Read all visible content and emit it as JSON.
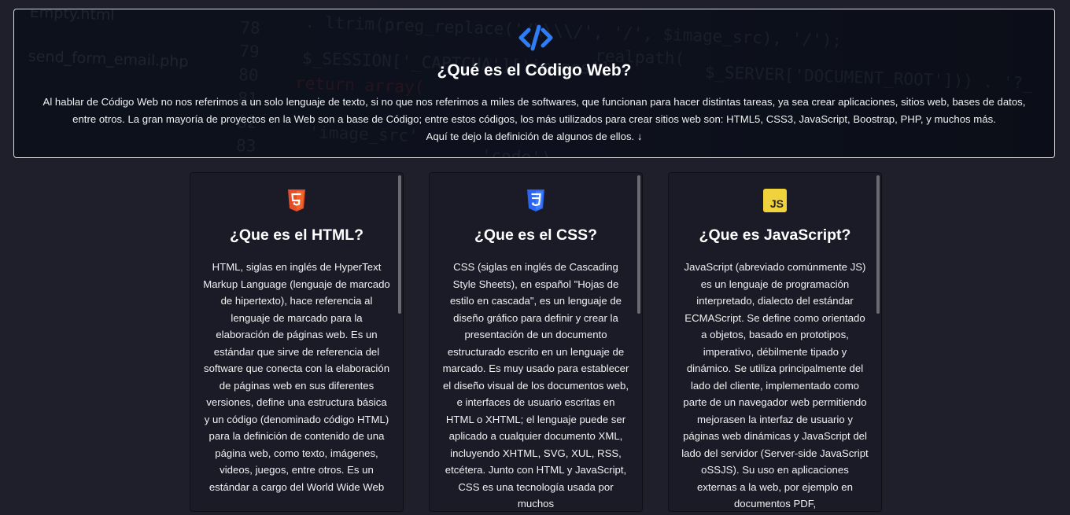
{
  "hero": {
    "title": "¿Qué es el Código Web?",
    "paragraph": "Al hablar de Código Web no nos referimos a un solo lenguaje de texto, si no que nos referimos a miles de softwares, que funcionan para hacer distintas tareas, ya sea crear aplicaciones, sitios web, bases de datos, entre otros. La gran mayoría de proyectos en la Web son a base de Código; entre estos códigos, los más utilizados para crear sitios web son: HTML5, CSS3, JavaScript, Boostrap, PHP, y muchos más.",
    "subtext": "Aquí te dejo la definición de algunos de ellos. ↓",
    "icon": "code-icon",
    "accent": "#2f7df6",
    "background_code": {
      "lines": [
        "Empty.html",
        "send_form_email.php",
        "$_SESSION['_CAPTCHA']['images'] = ",
        ". ltrim(preg_replace('/\\\\\\\\/', '/', $image_src), '/');",
        "$_SERVER['DOCUMENT_ROOT'])) . '?_",
        "realpath(",
        "return array(",
        "'image_src'",
        "'code')",
        "78",
        "79",
        "80",
        "81",
        "82",
        "83"
      ]
    }
  },
  "cards": [
    {
      "icon": "html5-icon",
      "icon_color": "#e44d26",
      "title": "¿Que es el HTML?",
      "body": "HTML, siglas en inglés de HyperText Markup Language (lenguaje de marcado de hipertexto), hace referencia al lenguaje de marcado para la elaboración de páginas web. Es un estándar que sirve de referencia del software que conecta con la elaboración de páginas web en sus diferentes versiones, define una estructura básica y un código (denominado código HTML) para la definición de contenido de una página web, como texto, imágenes, videos, juegos, entre otros. Es un estándar a cargo del World Wide Web"
    },
    {
      "icon": "css3-icon",
      "icon_color": "#2965f1",
      "title": "¿Que es el CSS?",
      "body": "CSS (siglas en inglés de Cascading Style Sheets), en español \"Hojas de estilo en cascada\", es un lenguaje de diseño gráfico para definir y crear la presentación de un documento estructurado escrito en un lenguaje de marcado. Es muy usado para establecer el diseño visual de los documentos web, e interfaces de usuario escritas en HTML o XHTML; el lenguaje puede ser aplicado a cualquier documento XML, incluyendo XHTML, SVG, XUL, RSS, etcétera. Junto con HTML y JavaScript, CSS es una tecnología usada por muchos"
    },
    {
      "icon": "javascript-icon",
      "icon_color": "#f0d23c",
      "icon_text": "JS",
      "title": "¿Que es JavaScript?",
      "body": "JavaScript (abreviado comúnmente JS) es un lenguaje de programación interpretado, dialecto del estándar ECMAScript. Se define como orientado a objetos, basado en prototipos, imperativo, débilmente tipado y dinámico. Se utiliza principalmente del lado del cliente, implementado como parte de un navegador web permitiendo mejorasen la interfaz de usuario y páginas web dinámicas y JavaScript del lado del servidor (Server-side JavaScript oSSJS). Su uso en aplicaciones externas a la web, por ejemplo en documentos PDF,"
    }
  ]
}
